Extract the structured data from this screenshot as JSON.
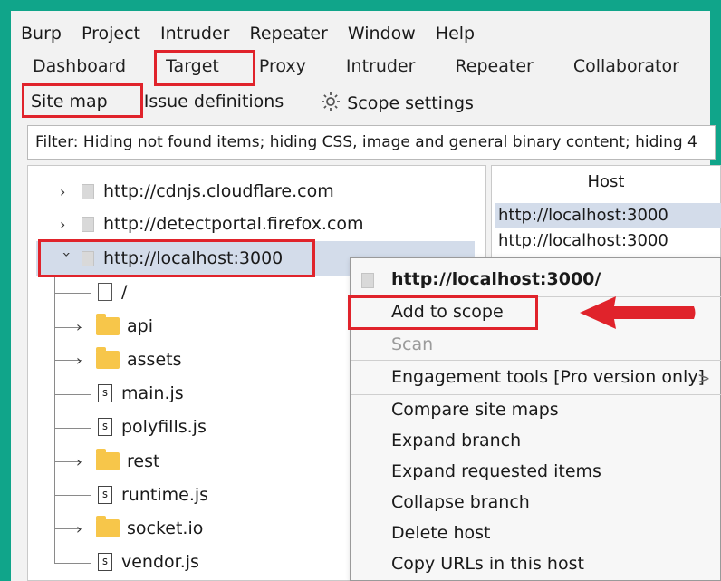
{
  "menubar": [
    "Burp",
    "Project",
    "Intruder",
    "Repeater",
    "Window",
    "Help"
  ],
  "main_tabs": [
    "Dashboard",
    "Target",
    "Proxy",
    "Intruder",
    "Repeater",
    "Collaborator"
  ],
  "sub_tabs": {
    "site_map": "Site map",
    "issue_definitions": "Issue definitions",
    "scope_settings": "Scope settings"
  },
  "filter": "Filter: Hiding not found items;  hiding CSS, image and general binary content;  hiding 4",
  "tree": {
    "hosts": [
      "http://cdnjs.cloudflare.com",
      "http://detectportal.firefox.com",
      "http://localhost:3000"
    ],
    "children": [
      "/",
      "api",
      "assets",
      "main.js",
      "polyfills.js",
      "rest",
      "runtime.js",
      "socket.io",
      "vendor.js"
    ]
  },
  "host_table": {
    "header": "Host",
    "rows": [
      "http://localhost:3000",
      "http://localhost:3000"
    ]
  },
  "context_menu": {
    "header": "http://localhost:3000/",
    "items": [
      "Add to scope",
      "Scan",
      "Engagement tools [Pro version only]",
      "Compare site maps",
      "Expand branch",
      "Expand requested items",
      "Collapse branch",
      "Delete host",
      "Copy URLs in this host"
    ],
    "submenu_arrow": ">"
  },
  "colors": {
    "frame": "#10a58a",
    "highlight": "#e0232b",
    "selection": "#d3dcea",
    "folder": "#f7c64a"
  }
}
